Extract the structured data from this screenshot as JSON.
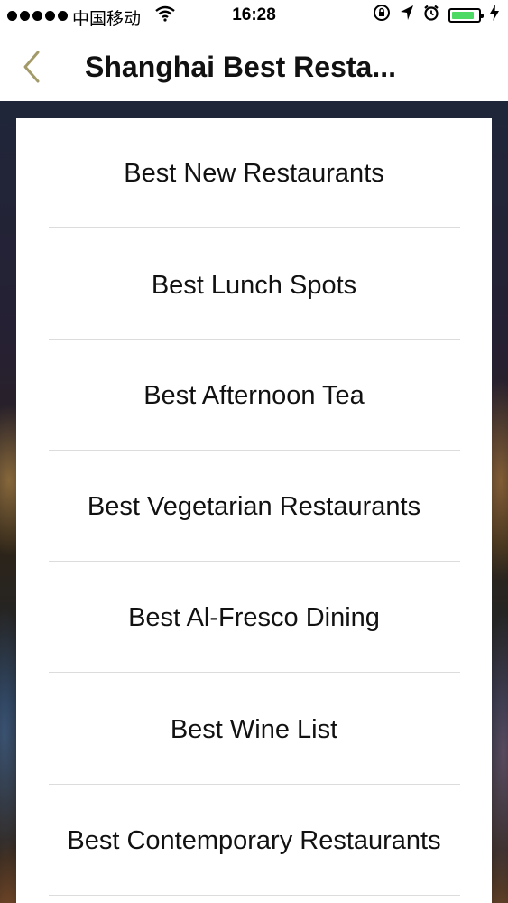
{
  "status_bar": {
    "carrier": "中国移动",
    "time": "16:28",
    "battery_color": "#4cd964",
    "battery_level": 0.85
  },
  "nav": {
    "title": "Shanghai Best Resta..."
  },
  "menu": {
    "items": [
      {
        "label": "Best New Restaurants"
      },
      {
        "label": "Best Lunch Spots"
      },
      {
        "label": "Best Afternoon Tea"
      },
      {
        "label": "Best Vegetarian Restaurants"
      },
      {
        "label": "Best Al-Fresco Dining"
      },
      {
        "label": "Best Wine List"
      },
      {
        "label": "Best Contemporary Restaurants"
      }
    ]
  },
  "colors": {
    "back_chevron": "#a39a6a"
  }
}
